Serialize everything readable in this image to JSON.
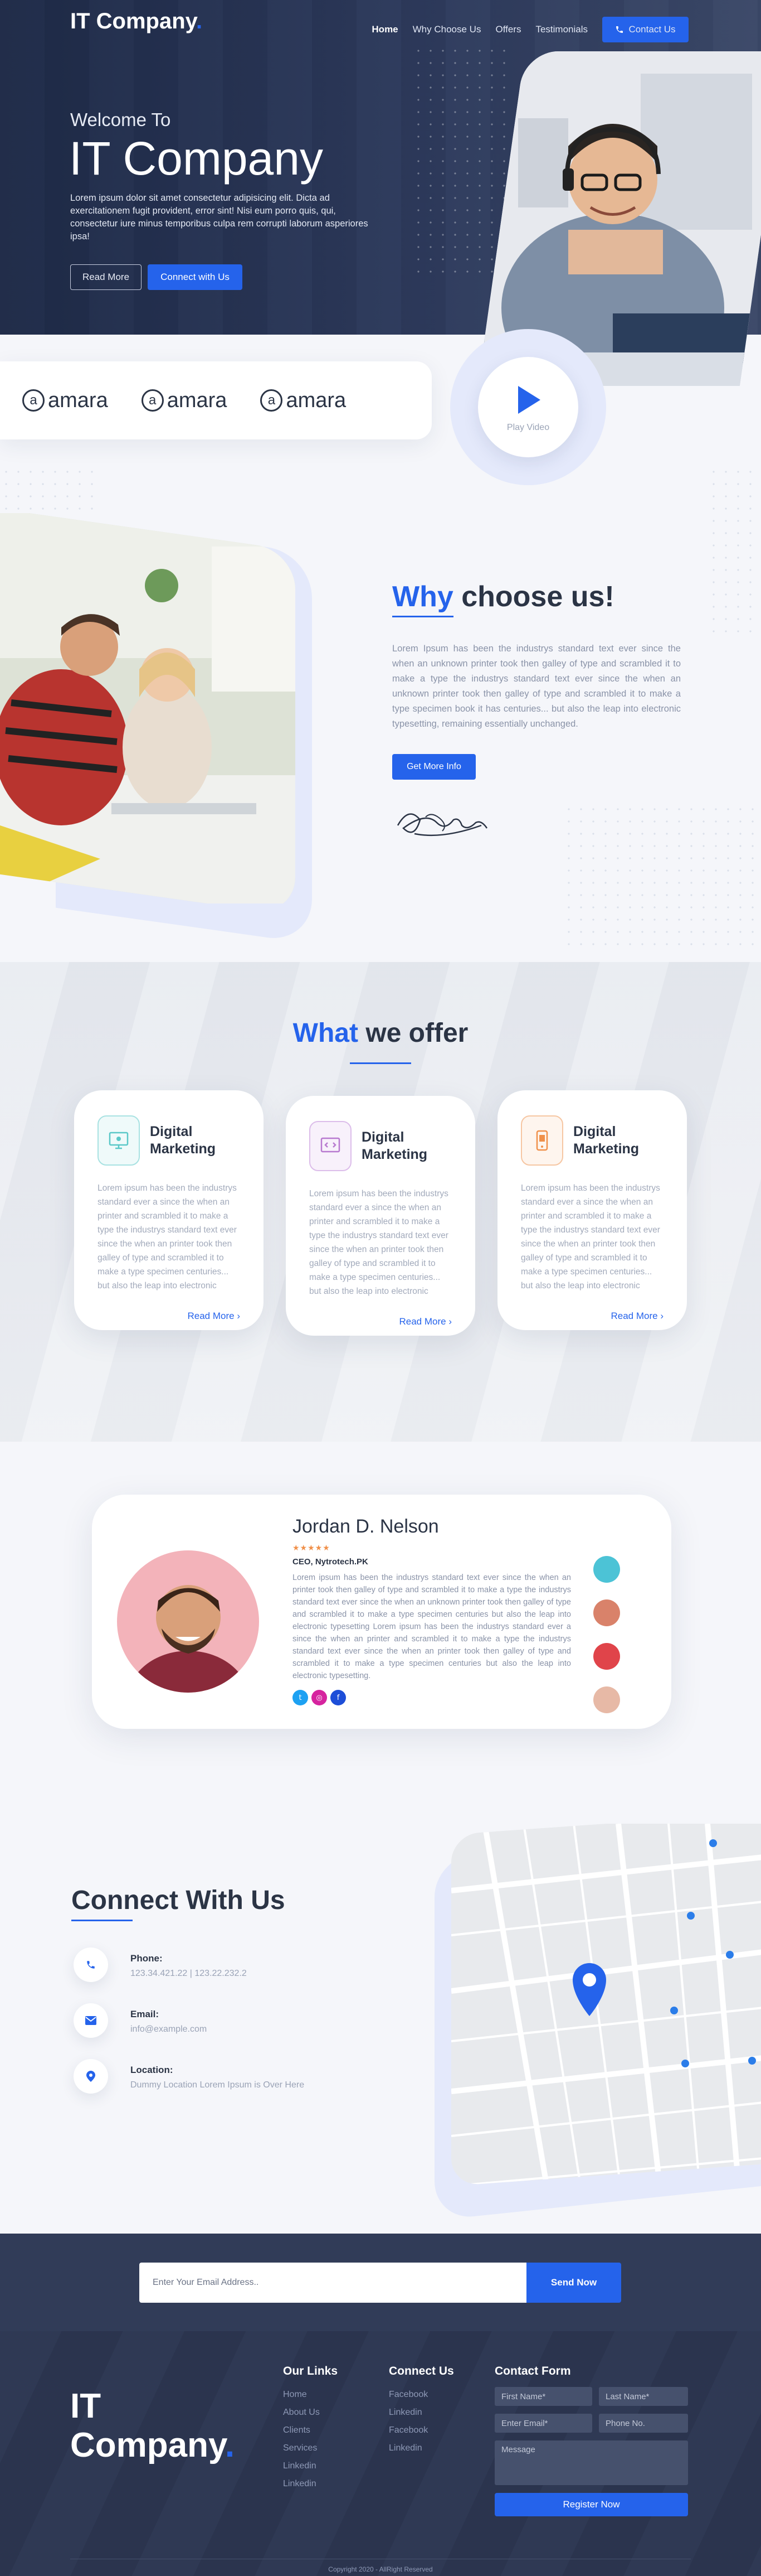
{
  "brand": {
    "name": "IT Company",
    "dot": "."
  },
  "nav": {
    "items": [
      "Home",
      "Why Choose Us",
      "Offers",
      "Testimonials"
    ],
    "contact_button": "Contact Us"
  },
  "hero": {
    "welcome": "Welcome To",
    "title": "IT Company",
    "text": "Lorem ipsum dolor sit amet consectetur adipisicing elit. Dicta ad exercitationem fugit provident, error sint! Nisi eum porro quis, qui, consectetur iure minus temporibus culpa rem corrupti laborum asperiores ipsa!",
    "read_more": "Read More",
    "connect": "Connect with Us"
  },
  "partners": [
    "amara",
    "amara",
    "amara"
  ],
  "video": {
    "label": "Play Video"
  },
  "why": {
    "title_accent": "Why",
    "title_rest": "choose us!",
    "text": "Lorem Ipsum has been the industrys standard text ever since the when an unknown printer took then galley of type and scrambled it to make a type the industrys standard text ever since the when an unknown printer took then galley of type and scrambled it to make a type specimen book it has centuries... but also the leap into electronic typesetting, remaining essentially unchanged.",
    "button": "Get More Info"
  },
  "offers": {
    "title_accent": "What",
    "title_rest": "we offer",
    "cards": [
      {
        "title_1": "Digital",
        "title_2": "Marketing",
        "text": "Lorem ipsum has been the industrys standard ever a since the when an printer and scrambled it to make a type the industrys standard text ever since the when an printer took then galley of type and scrambled it to make a type specimen centuries... but also the leap into electronic",
        "link": "Read More",
        "color": "#5bc8c8"
      },
      {
        "title_1": "Digital",
        "title_2": "Marketing",
        "text": "Lorem ipsum has been the industrys standard ever a since the when an printer and scrambled it to make a type the industrys standard text ever since the when an printer took then galley of type and scrambled it to make a type specimen centuries... but also the leap into electronic",
        "link": "Read More",
        "color": "#b87ad0"
      },
      {
        "title_1": "Digital",
        "title_2": "Marketing",
        "text": "Lorem ipsum has been the industrys standard ever a since the when an printer and scrambled it to make a type the industrys standard text ever since the when an printer took then galley of type and scrambled it to make a type specimen centuries... but also the leap into electronic",
        "link": "Read More",
        "color": "#f0904a"
      }
    ]
  },
  "testimonial": {
    "name": "Jordan D. Nelson",
    "stars": "★★★★★",
    "role": "CEO, Nytrotech.PK",
    "text": "Lorem ipsum has been the industrys standard text ever since the when an printer took then galley of type and scrambled it to make a type the industrys standard text ever since the when an unknown printer took then galley of type and scrambled it to make a type specimen centuries but also the leap into electronic typesetting Lorem ipsum has been the industrys standard ever a since the when an printer and scrambled it to make a type the industrys standard text ever since the when an printer took then galley of type and scrambled it to make a type specimen centuries but also the leap into electronic typesetting."
  },
  "contact": {
    "title": "Connect With Us",
    "phone_label": "Phone:",
    "phone_value": "123.34.421.22 | 123.22.232.2",
    "email_label": "Email:",
    "email_value": "info@example.com",
    "location_label": "Location:",
    "location_value": "Dummy Location Lorem Ipsum is Over Here"
  },
  "subscribe": {
    "placeholder": "Enter Your Email Address..",
    "button": "Send Now"
  },
  "footer": {
    "logo_1": "IT",
    "logo_2": "Company",
    "links_title": "Our Links",
    "links": [
      "Home",
      "About Us",
      "Clients",
      "Services",
      "Linkedin",
      "Linkedin"
    ],
    "connect_title": "Connect Us",
    "connect": [
      "Facebook",
      "Linkedin",
      "Facebook",
      "Linkedin"
    ],
    "form_title": "Contact Form",
    "first_name": "First Name*",
    "last_name": "Last Name*",
    "email": "Enter Email*",
    "phone": "Phone No.",
    "message": "Message",
    "register": "Register Now",
    "copyright": "Copyright 2020 - AllRight Reserved"
  }
}
